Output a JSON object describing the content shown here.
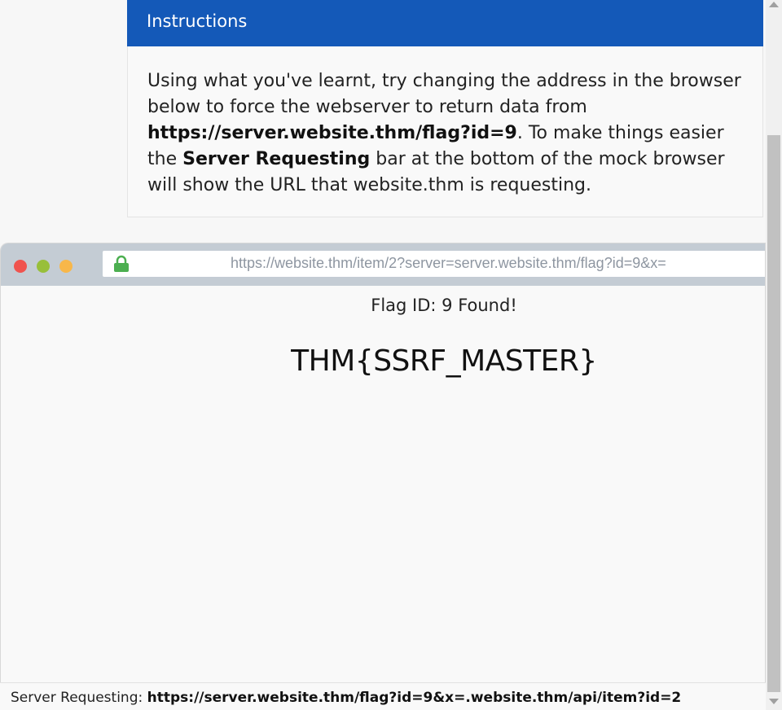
{
  "instructions": {
    "header": "Instructions",
    "text_part1": "Using what you've learnt, try changing the address in the browser below to force the webserver to return data from ",
    "flag_url": "https://server.website.thm/flag?id=9",
    "text_part2": ". To make things easier the ",
    "bar_name": "Server Requesting",
    "text_part3": " bar at the bottom of the mock browser will show the URL that website.thm is requesting."
  },
  "browser": {
    "url": "https://website.thm/item/2?server=server.website.thm/flag?id=9&x=",
    "lock_icon": "lock-icon",
    "content": {
      "flag_id_text": "Flag ID: 9 Found!",
      "flag_value": "THM{SSRF_MASTER}"
    }
  },
  "status_bar": {
    "label": "Server Requesting: ",
    "url": "https://server.website.thm/flag?id=9&x=.website.thm/api/item?id=2"
  },
  "colors": {
    "header_bg": "#1459b8",
    "dot_red": "#f0534e",
    "dot_green": "#98bf3a",
    "dot_orange": "#f8b74a",
    "lock": "#4caf50"
  }
}
